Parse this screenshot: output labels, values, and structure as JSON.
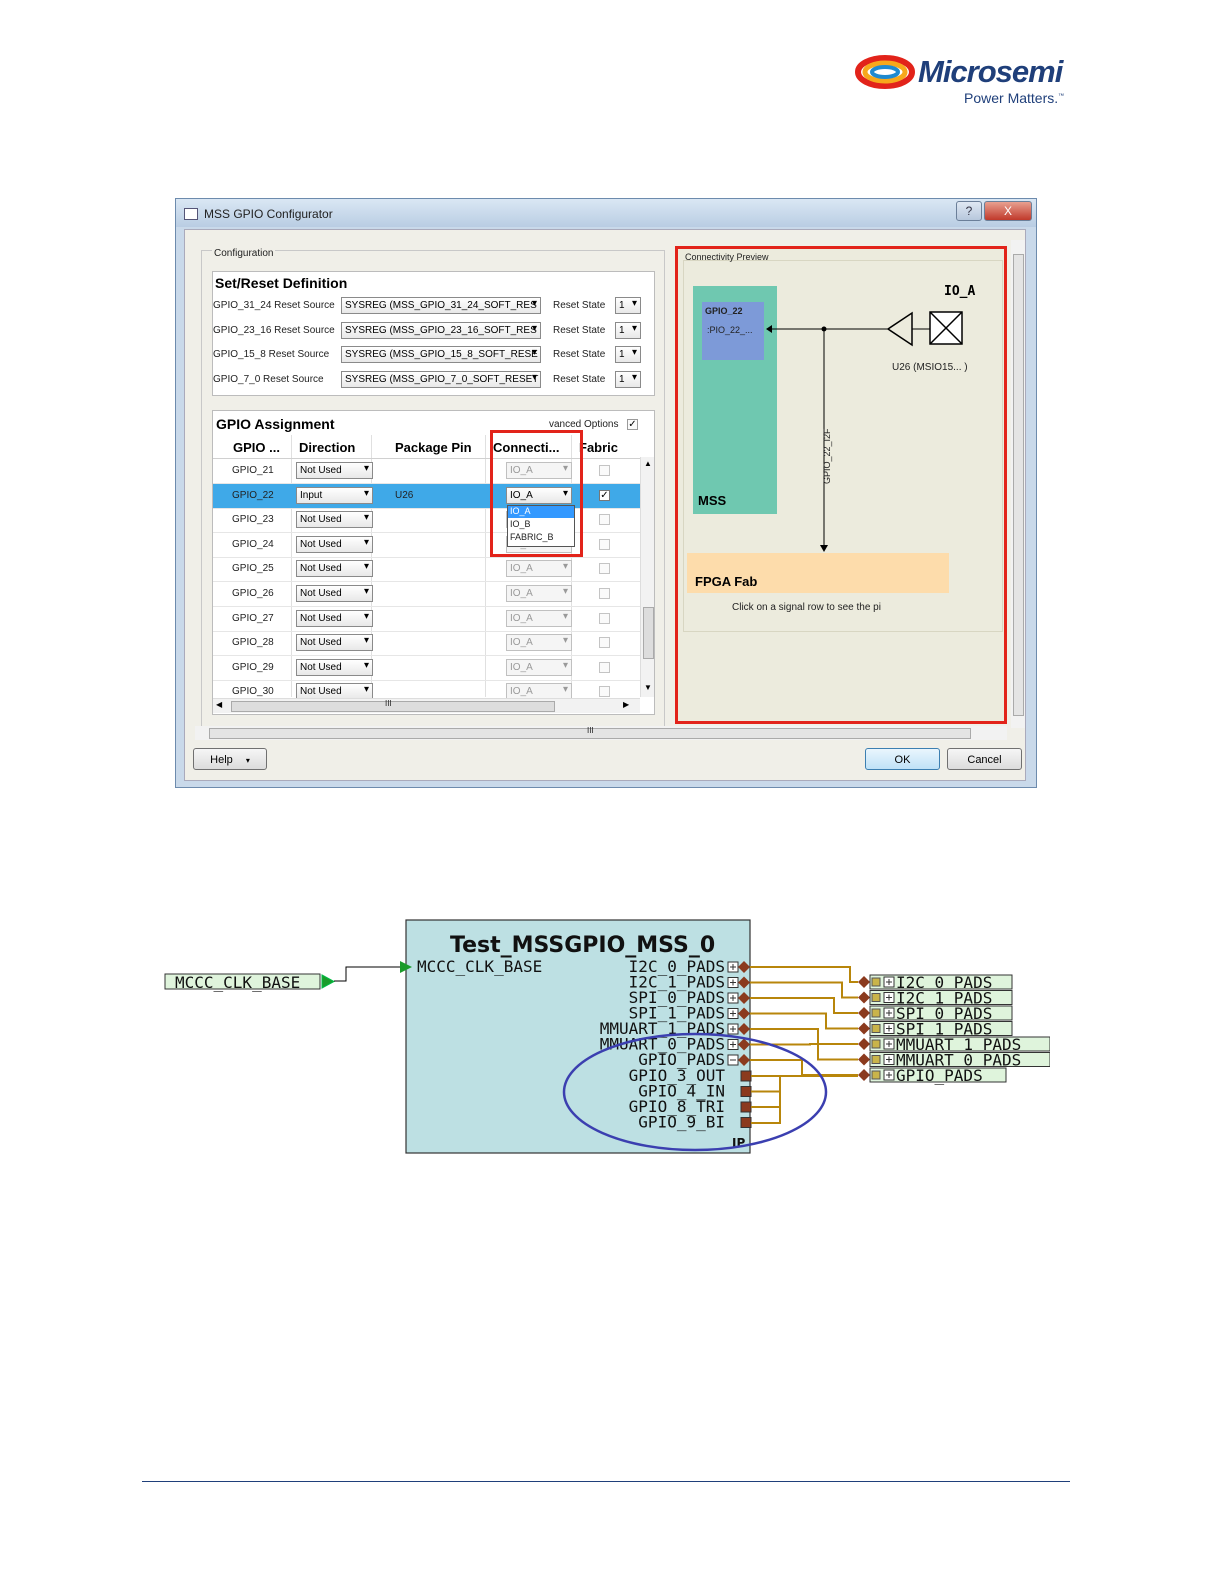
{
  "logo": {
    "name": "Microsemi",
    "tagline": "Power Matters.",
    "tm": "™"
  },
  "dialog": {
    "title": "MSS GPIO Configurator",
    "help_button": "?",
    "close_button": "X",
    "configuration_label": "Configuration",
    "set_reset": {
      "heading": "Set/Reset Definition",
      "rows": [
        {
          "label": "GPIO_31_24 Reset Source",
          "source": "SYSREG (MSS_GPIO_31_24_SOFT_RES",
          "state_label": "Reset State",
          "state": "1"
        },
        {
          "label": "GPIO_23_16 Reset Source",
          "source": "SYSREG (MSS_GPIO_23_16_SOFT_RES",
          "state_label": "Reset State",
          "state": "1"
        },
        {
          "label": "GPIO_15_8 Reset Source",
          "source": "SYSREG (MSS_GPIO_15_8_SOFT_RESE",
          "state_label": "Reset State",
          "state": "1"
        },
        {
          "label": "GPIO_7_0 Reset Source",
          "source": "SYSREG (MSS_GPIO_7_0_SOFT_RESET",
          "state_label": "Reset State",
          "state": "1"
        }
      ]
    },
    "assignment": {
      "heading": "GPIO Assignment",
      "advanced_options": "vanced Options",
      "columns": [
        "GPIO ...",
        "Direction",
        "Package Pin",
        "Connecti...",
        "Fabric"
      ],
      "rows": [
        {
          "gpio": "GPIO_21",
          "direction": "Not Used",
          "pin": "",
          "conn": "IO_A",
          "fabric": false,
          "selected": false
        },
        {
          "gpio": "GPIO_22",
          "direction": "Input",
          "pin": "U26",
          "conn": "IO_A",
          "fabric": true,
          "selected": true
        },
        {
          "gpio": "GPIO_23",
          "direction": "Not Used",
          "pin": "",
          "conn": "",
          "fabric": false,
          "selected": false
        },
        {
          "gpio": "GPIO_24",
          "direction": "Not Used",
          "pin": "",
          "conn": "IO_A",
          "fabric": false,
          "selected": false
        },
        {
          "gpio": "GPIO_25",
          "direction": "Not Used",
          "pin": "",
          "conn": "IO_A",
          "fabric": false,
          "selected": false
        },
        {
          "gpio": "GPIO_26",
          "direction": "Not Used",
          "pin": "",
          "conn": "IO_A",
          "fabric": false,
          "selected": false
        },
        {
          "gpio": "GPIO_27",
          "direction": "Not Used",
          "pin": "",
          "conn": "IO_A",
          "fabric": false,
          "selected": false
        },
        {
          "gpio": "GPIO_28",
          "direction": "Not Used",
          "pin": "",
          "conn": "IO_A",
          "fabric": false,
          "selected": false
        },
        {
          "gpio": "GPIO_29",
          "direction": "Not Used",
          "pin": "",
          "conn": "IO_A",
          "fabric": false,
          "selected": false
        },
        {
          "gpio": "GPIO_30",
          "direction": "Not Used",
          "pin": "",
          "conn": "IO_A",
          "fabric": false,
          "selected": false
        }
      ],
      "dropdown_options": [
        "IO_A",
        "IO_B",
        "FABRIC_B"
      ],
      "scroll_marker": "III"
    },
    "preview": {
      "label": "Connectivity Preview",
      "gpio_block": "GPIO_22",
      "gpio_port": ":PIO_22_...",
      "mss_label": "MSS",
      "io_label": "IO_A",
      "pin_label": "U26 (MSIO15... )",
      "signal_label": "GPIO_22_I2F",
      "fabric_label": "FPGA Fab",
      "hint": "Click on a signal row to see the pi"
    },
    "bottom_scroll_marker": "III",
    "buttons": {
      "help": "Help",
      "ok": "OK",
      "cancel": "Cancel"
    }
  },
  "diagram": {
    "block_title": "Test_MSSGPIO_MSS_0",
    "input_port": "MCCC_CLK_BASE",
    "external_input": "MCCC_CLK_BASE",
    "ports": [
      "I2C_0_PADS",
      "I2C_1_PADS",
      "SPI_0_PADS",
      "SPI_1_PADS",
      "MMUART_1_PADS",
      "MMUART_0_PADS",
      "GPIO_PADS",
      "GPIO_3_OUT",
      "GPIO_4_IN",
      "GPIO_8_TRI",
      "GPIO_9_BI"
    ],
    "outputs": [
      "I2C_0_PADS",
      "I2C_1_PADS",
      "SPI_0_PADS",
      "SPI_1_PADS",
      "MMUART_1_PADS",
      "MMUART_0_PADS",
      "GPIO_PADS"
    ],
    "ip_badge": "IP"
  },
  "colors": {
    "highlight_red": "#e2231a",
    "ellipse_blue": "#3b3fb0",
    "row_selected": "#3fa9e8",
    "block_fill": "#bde0e3",
    "wire": "#b8860b"
  }
}
